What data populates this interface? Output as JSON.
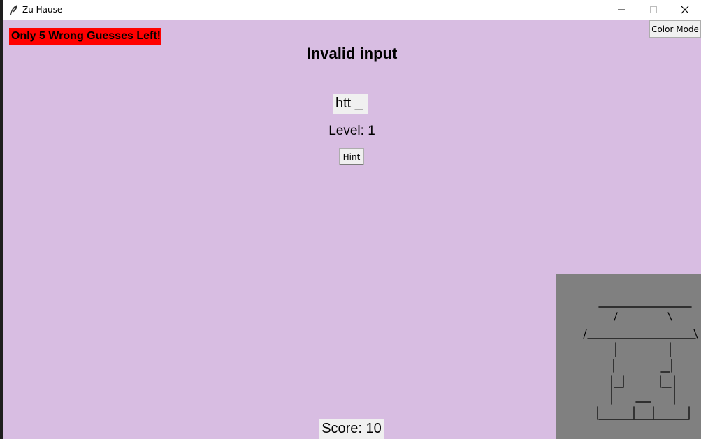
{
  "window": {
    "title": "Zu Hause",
    "icon": "feather-icon",
    "controls": [
      "minimize-icon",
      "maximize-icon",
      "close-icon"
    ]
  },
  "game": {
    "warning": "Only 5 Wrong Guesses Left!",
    "color_mode_label": "Color Mode",
    "status_message": "Invalid input",
    "word_display": "htt _",
    "level_text": "Level: 1",
    "hint_label": "Hint",
    "score_text": "Score: 10"
  },
  "colors": {
    "background": "#d8bde2",
    "warning_background": "#ff0000",
    "hangman_panel": "#808080",
    "button_face": "#f0f0f0"
  }
}
